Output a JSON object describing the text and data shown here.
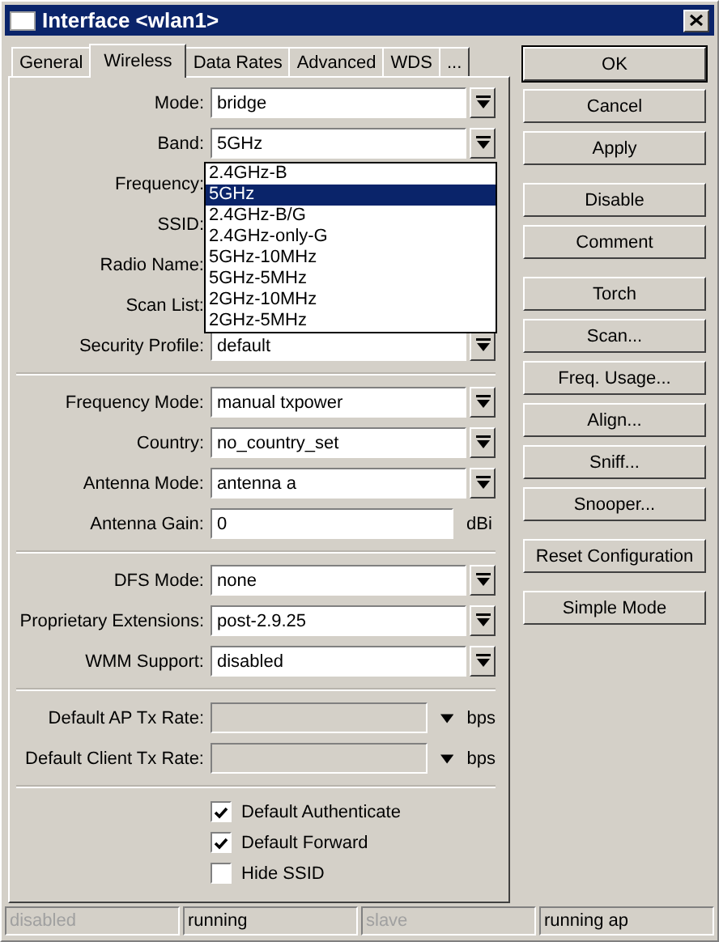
{
  "window": {
    "title": "Interface <wlan1>"
  },
  "tabs": [
    {
      "label": "General",
      "selected": false
    },
    {
      "label": "Wireless",
      "selected": true
    },
    {
      "label": "Data Rates",
      "selected": false
    },
    {
      "label": "Advanced",
      "selected": false
    },
    {
      "label": "WDS",
      "selected": false
    },
    {
      "label": "...",
      "selected": false
    }
  ],
  "sections": [
    {
      "rows": [
        {
          "kind": "combo",
          "label": "Mode:",
          "value": "bridge"
        },
        {
          "kind": "combo",
          "label": "Band:",
          "value": "5GHz",
          "dropdown": {
            "options": [
              {
                "label": "2.4GHz-B",
                "selected": false
              },
              {
                "label": "5GHz",
                "selected": true
              },
              {
                "label": "2.4GHz-B/G",
                "selected": false
              },
              {
                "label": "2.4GHz-only-G",
                "selected": false
              },
              {
                "label": "5GHz-10MHz",
                "selected": false
              },
              {
                "label": "5GHz-5MHz",
                "selected": false
              },
              {
                "label": "2GHz-10MHz",
                "selected": false
              },
              {
                "label": "2GHz-5MHz",
                "selected": false
              }
            ]
          }
        },
        {
          "kind": "covered",
          "label": "Frequency:"
        },
        {
          "kind": "covered",
          "label": "SSID:"
        },
        {
          "kind": "covered",
          "label": "Radio Name:"
        },
        {
          "kind": "covered",
          "label": "Scan List:"
        },
        {
          "kind": "combo",
          "label": "Security Profile:",
          "value": "default"
        }
      ]
    },
    {
      "rows": [
        {
          "kind": "combo",
          "label": "Frequency Mode:",
          "value": "manual txpower"
        },
        {
          "kind": "combo",
          "label": "Country:",
          "value": "no_country_set"
        },
        {
          "kind": "combo",
          "label": "Antenna Mode:",
          "value": "antenna a"
        },
        {
          "kind": "text",
          "label": "Antenna Gain:",
          "value": "0",
          "unit": "dBi"
        }
      ]
    },
    {
      "rows": [
        {
          "kind": "combo",
          "label": "DFS Mode:",
          "value": "none"
        },
        {
          "kind": "combo",
          "label": "Proprietary Extensions:",
          "value": "post-2.9.25"
        },
        {
          "kind": "combo",
          "label": "WMM Support:",
          "value": "disabled"
        }
      ]
    },
    {
      "rows": [
        {
          "kind": "rate",
          "label": "Default AP Tx Rate:",
          "unit": "bps"
        },
        {
          "kind": "rate",
          "label": "Default Client Tx Rate:",
          "unit": "bps"
        }
      ]
    },
    {
      "rows": [
        {
          "kind": "checkbox",
          "label": "Default Authenticate",
          "checked": true
        },
        {
          "kind": "checkbox",
          "label": "Default Forward",
          "checked": true
        },
        {
          "kind": "checkbox",
          "label": "Hide SSID",
          "checked": false
        }
      ]
    }
  ],
  "button_groups": [
    [
      {
        "label": "OK",
        "default": true
      },
      {
        "label": "Cancel",
        "default": false
      },
      {
        "label": "Apply",
        "default": false
      }
    ],
    [
      {
        "label": "Disable",
        "default": false
      },
      {
        "label": "Comment",
        "default": false
      }
    ],
    [
      {
        "label": "Torch",
        "default": false
      },
      {
        "label": "Scan...",
        "default": false
      },
      {
        "label": "Freq. Usage...",
        "default": false
      },
      {
        "label": "Align...",
        "default": false
      },
      {
        "label": "Sniff...",
        "default": false
      },
      {
        "label": "Snooper...",
        "default": false
      }
    ],
    [
      {
        "label": "Reset Configuration",
        "default": false
      }
    ],
    [
      {
        "label": "Simple Mode",
        "default": false
      }
    ]
  ],
  "status_bar": [
    {
      "text": "disabled",
      "disabled": true
    },
    {
      "text": "running",
      "disabled": false
    },
    {
      "text": "slave",
      "disabled": true
    },
    {
      "text": "running ap",
      "disabled": false
    }
  ]
}
